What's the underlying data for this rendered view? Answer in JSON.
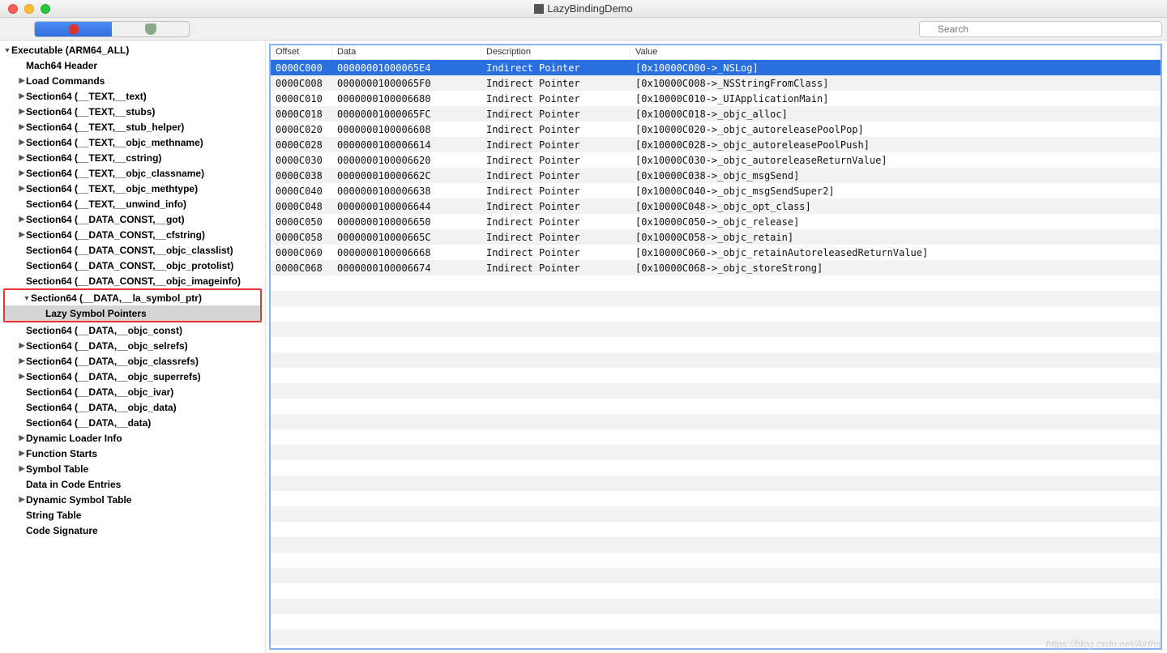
{
  "window": {
    "title": "LazyBindingDemo"
  },
  "toolbar": {
    "search_placeholder": "Search"
  },
  "tree": {
    "root": "Executable  (ARM64_ALL)",
    "items": [
      {
        "label": "Mach64 Header",
        "indent": 1,
        "arrow": ""
      },
      {
        "label": "Load Commands",
        "indent": 1,
        "arrow": "▶"
      },
      {
        "label": "Section64 (__TEXT,__text)",
        "indent": 1,
        "arrow": "▶"
      },
      {
        "label": "Section64 (__TEXT,__stubs)",
        "indent": 1,
        "arrow": "▶"
      },
      {
        "label": "Section64 (__TEXT,__stub_helper)",
        "indent": 1,
        "arrow": "▶"
      },
      {
        "label": "Section64 (__TEXT,__objc_methname)",
        "indent": 1,
        "arrow": "▶"
      },
      {
        "label": "Section64 (__TEXT,__cstring)",
        "indent": 1,
        "arrow": "▶"
      },
      {
        "label": "Section64 (__TEXT,__objc_classname)",
        "indent": 1,
        "arrow": "▶"
      },
      {
        "label": "Section64 (__TEXT,__objc_methtype)",
        "indent": 1,
        "arrow": "▶"
      },
      {
        "label": "Section64 (__TEXT,__unwind_info)",
        "indent": 1,
        "arrow": ""
      },
      {
        "label": "Section64 (__DATA_CONST,__got)",
        "indent": 1,
        "arrow": "▶"
      },
      {
        "label": "Section64 (__DATA_CONST,__cfstring)",
        "indent": 1,
        "arrow": "▶"
      },
      {
        "label": "Section64 (__DATA_CONST,__objc_classlist)",
        "indent": 1,
        "arrow": ""
      },
      {
        "label": "Section64 (__DATA_CONST,__objc_protolist)",
        "indent": 1,
        "arrow": ""
      },
      {
        "label": "Section64 (__DATA_CONST,__objc_imageinfo)",
        "indent": 1,
        "arrow": ""
      },
      {
        "label": "Section64 (__DATA,__la_symbol_ptr)",
        "indent": 1,
        "arrow": "▼",
        "hl": true
      },
      {
        "label": "Lazy Symbol Pointers",
        "indent": 2,
        "arrow": "",
        "sel": true,
        "hl": true
      },
      {
        "label": "Section64 (__DATA,__objc_const)",
        "indent": 1,
        "arrow": ""
      },
      {
        "label": "Section64 (__DATA,__objc_selrefs)",
        "indent": 1,
        "arrow": "▶"
      },
      {
        "label": "Section64 (__DATA,__objc_classrefs)",
        "indent": 1,
        "arrow": "▶"
      },
      {
        "label": "Section64 (__DATA,__objc_superrefs)",
        "indent": 1,
        "arrow": "▶"
      },
      {
        "label": "Section64 (__DATA,__objc_ivar)",
        "indent": 1,
        "arrow": ""
      },
      {
        "label": "Section64 (__DATA,__objc_data)",
        "indent": 1,
        "arrow": ""
      },
      {
        "label": "Section64 (__DATA,__data)",
        "indent": 1,
        "arrow": ""
      },
      {
        "label": "Dynamic Loader Info",
        "indent": 1,
        "arrow": "▶"
      },
      {
        "label": "Function Starts",
        "indent": 1,
        "arrow": "▶"
      },
      {
        "label": "Symbol Table",
        "indent": 1,
        "arrow": "▶"
      },
      {
        "label": "Data in Code Entries",
        "indent": 1,
        "arrow": ""
      },
      {
        "label": "Dynamic Symbol Table",
        "indent": 1,
        "arrow": "▶"
      },
      {
        "label": "String Table",
        "indent": 1,
        "arrow": ""
      },
      {
        "label": "Code Signature",
        "indent": 1,
        "arrow": ""
      }
    ]
  },
  "table": {
    "headers": {
      "offset": "Offset",
      "data": "Data",
      "desc": "Description",
      "value": "Value"
    },
    "rows": [
      {
        "offset": "0000C000",
        "data": "00000001000065E4",
        "desc": "Indirect Pointer",
        "value": "[0x10000C000->_NSLog]",
        "sel": true
      },
      {
        "offset": "0000C008",
        "data": "00000001000065F0",
        "desc": "Indirect Pointer",
        "value": "[0x10000C008->_NSStringFromClass]"
      },
      {
        "offset": "0000C010",
        "data": "0000000100006680",
        "desc": "Indirect Pointer",
        "value": "[0x10000C010->_UIApplicationMain]"
      },
      {
        "offset": "0000C018",
        "data": "00000001000065FC",
        "desc": "Indirect Pointer",
        "value": "[0x10000C018->_objc_alloc]"
      },
      {
        "offset": "0000C020",
        "data": "0000000100006608",
        "desc": "Indirect Pointer",
        "value": "[0x10000C020->_objc_autoreleasePoolPop]"
      },
      {
        "offset": "0000C028",
        "data": "0000000100006614",
        "desc": "Indirect Pointer",
        "value": "[0x10000C028->_objc_autoreleasePoolPush]"
      },
      {
        "offset": "0000C030",
        "data": "0000000100006620",
        "desc": "Indirect Pointer",
        "value": "[0x10000C030->_objc_autoreleaseReturnValue]"
      },
      {
        "offset": "0000C038",
        "data": "000000010000662C",
        "desc": "Indirect Pointer",
        "value": "[0x10000C038->_objc_msgSend]"
      },
      {
        "offset": "0000C040",
        "data": "0000000100006638",
        "desc": "Indirect Pointer",
        "value": "[0x10000C040->_objc_msgSendSuper2]"
      },
      {
        "offset": "0000C048",
        "data": "0000000100006644",
        "desc": "Indirect Pointer",
        "value": "[0x10000C048->_objc_opt_class]"
      },
      {
        "offset": "0000C050",
        "data": "0000000100006650",
        "desc": "Indirect Pointer",
        "value": "[0x10000C050->_objc_release]"
      },
      {
        "offset": "0000C058",
        "data": "000000010000665C",
        "desc": "Indirect Pointer",
        "value": "[0x10000C058->_objc_retain]"
      },
      {
        "offset": "0000C060",
        "data": "0000000100006668",
        "desc": "Indirect Pointer",
        "value": "[0x10000C060->_objc_retainAutoreleasedReturnValue]"
      },
      {
        "offset": "0000C068",
        "data": "0000000100006674",
        "desc": "Indirect Pointer",
        "value": "[0x10000C068->_objc_storeStrong]"
      }
    ],
    "padding_rows": 24
  },
  "watermark": "https://blog.csdn.net/Airths"
}
